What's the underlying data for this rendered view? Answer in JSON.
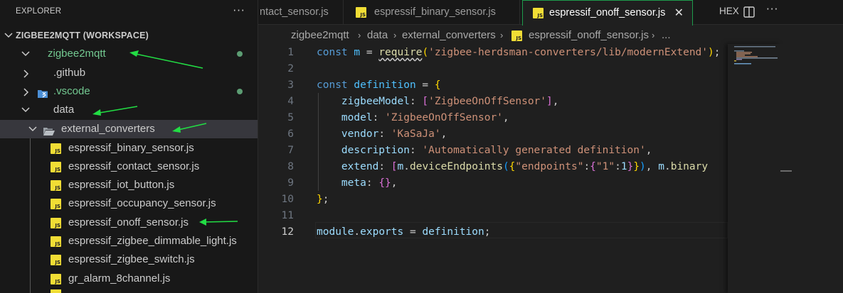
{
  "explorer": {
    "title": "EXPLORER",
    "more": "···",
    "workspace": "ZIGBEE2MQTT (WORKSPACE)",
    "tree": [
      {
        "label": "zigbee2mqtt",
        "type": "folder-open",
        "color": "#73c991",
        "git_dot": true
      },
      {
        "label": ".github",
        "type": "folder-closed"
      },
      {
        "label": ".vscode",
        "type": "folder-closed",
        "color": "#73c991",
        "git_dot": true,
        "icon": "vscode-icon"
      },
      {
        "label": "data",
        "type": "folder-open"
      },
      {
        "label": "external_converters",
        "type": "folder-open",
        "selected": true,
        "icon": "folder-icon"
      },
      {
        "label": "espressif_binary_sensor.js",
        "type": "file"
      },
      {
        "label": "espressif_contact_sensor.js",
        "type": "file"
      },
      {
        "label": "espressif_iot_button.js",
        "type": "file"
      },
      {
        "label": "espressif_occupancy_sensor.js",
        "type": "file"
      },
      {
        "label": "espressif_onoff_sensor.js",
        "type": "file"
      },
      {
        "label": "espressif_zigbee_dimmable_light.js",
        "type": "file"
      },
      {
        "label": "espressif_zigbee_switch.js",
        "type": "file"
      },
      {
        "label": "gr_alarm_8channel.js",
        "type": "file"
      }
    ]
  },
  "tabs": [
    {
      "label": "ntact_sensor.js",
      "active": false
    },
    {
      "label": "espressif_binary_sensor.js",
      "active": false
    },
    {
      "label": "espressif_onoff_sensor.js",
      "active": true
    }
  ],
  "toolbar": {
    "hex": "HEX",
    "more": "···",
    "close": "✕"
  },
  "breadcrumb": [
    "zigbee2mqtt",
    "data",
    "external_converters",
    "espressif_onoff_sensor.js",
    "..."
  ],
  "editor": {
    "line_numbers": [
      "1",
      "2",
      "3",
      "4",
      "5",
      "6",
      "7",
      "8",
      "9",
      "10",
      "11",
      "12"
    ],
    "active_line": 12,
    "lines": [
      [
        [
          "kw",
          "const "
        ],
        [
          "const",
          "m"
        ],
        [
          "plain",
          " = "
        ],
        [
          "fn",
          "require"
        ],
        [
          "br1",
          "("
        ],
        [
          "str",
          "'zigbee-herdsman-converters/lib/modernExtend'"
        ],
        [
          "br1",
          ")"
        ],
        [
          "plain",
          ";"
        ]
      ],
      [],
      [
        [
          "kw",
          "const "
        ],
        [
          "const",
          "definition"
        ],
        [
          "plain",
          " = "
        ],
        [
          "br1",
          "{"
        ]
      ],
      [
        [
          "plain",
          "    "
        ],
        [
          "var",
          "zigbeeModel"
        ],
        [
          "plain",
          ": "
        ],
        [
          "br2",
          "["
        ],
        [
          "str",
          "'ZigbeeOnOffSensor'"
        ],
        [
          "br2",
          "]"
        ],
        [
          "plain",
          ","
        ]
      ],
      [
        [
          "plain",
          "    "
        ],
        [
          "var",
          "model"
        ],
        [
          "plain",
          ": "
        ],
        [
          "str",
          "'ZigbeeOnOffSensor'"
        ],
        [
          "plain",
          ","
        ]
      ],
      [
        [
          "plain",
          "    "
        ],
        [
          "var",
          "vendor"
        ],
        [
          "plain",
          ": "
        ],
        [
          "str",
          "'KaSaJa'"
        ],
        [
          "plain",
          ","
        ]
      ],
      [
        [
          "plain",
          "    "
        ],
        [
          "var",
          "description"
        ],
        [
          "plain",
          ": "
        ],
        [
          "str",
          "'Automatically generated definition'"
        ],
        [
          "plain",
          ","
        ]
      ],
      [
        [
          "plain",
          "    "
        ],
        [
          "var",
          "extend"
        ],
        [
          "plain",
          ": "
        ],
        [
          "br2",
          "["
        ],
        [
          "var",
          "m"
        ],
        [
          "plain",
          "."
        ],
        [
          "fn",
          "deviceEndpoints"
        ],
        [
          "br3",
          "("
        ],
        [
          "br1",
          "{"
        ],
        [
          "str",
          "\"endpoints\""
        ],
        [
          "plain",
          ":"
        ],
        [
          "br2",
          "{"
        ],
        [
          "str",
          "\"1\""
        ],
        [
          "plain",
          ":"
        ],
        [
          "var",
          "1"
        ],
        [
          "br2",
          "}"
        ],
        [
          "br1",
          "}"
        ],
        [
          "br3",
          ")"
        ],
        [
          "plain",
          ", "
        ],
        [
          "var",
          "m"
        ],
        [
          "plain",
          "."
        ],
        [
          "fn",
          "binary"
        ]
      ],
      [
        [
          "plain",
          "    "
        ],
        [
          "var",
          "meta"
        ],
        [
          "plain",
          ": "
        ],
        [
          "br2",
          "{}"
        ],
        [
          "plain",
          ","
        ]
      ],
      [
        [
          "br1",
          "}"
        ],
        [
          "plain",
          ";"
        ]
      ],
      [],
      [
        [
          "var",
          "module"
        ],
        [
          "plain",
          "."
        ],
        [
          "var",
          "exports"
        ],
        [
          "plain",
          " = "
        ],
        [
          "var",
          "definition"
        ],
        [
          "plain",
          ";"
        ]
      ]
    ]
  },
  "colors": {
    "accent_green": "#1e9b4c",
    "git_modified": "#73c991",
    "js_icon": "#f1dd35",
    "annotation_arrow": "#22dd44"
  }
}
